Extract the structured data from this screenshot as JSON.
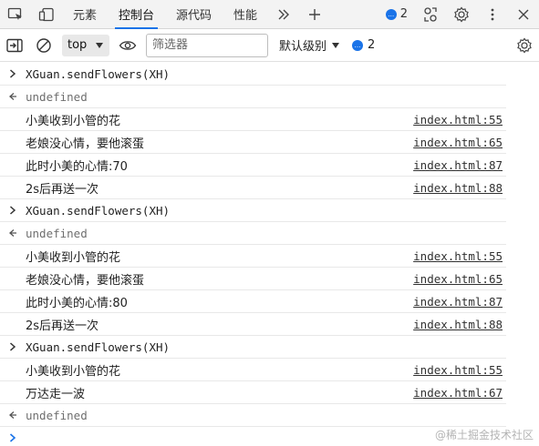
{
  "tabbar": {
    "tabs": [
      {
        "label": "元素",
        "active": false
      },
      {
        "label": "控制台",
        "active": true
      },
      {
        "label": "源代码",
        "active": false
      },
      {
        "label": "性能",
        "active": false
      }
    ],
    "more_icon": "chevron-double-right-icon",
    "add_icon": "plus-icon",
    "message_count": "2",
    "accent_color": "#1a73e8"
  },
  "toolbar": {
    "context": "top",
    "filter_placeholder": "筛选器",
    "filter_value": "",
    "levels_label": "默认级别",
    "issue_count": "2"
  },
  "console": {
    "entries": [
      {
        "kind": "input",
        "text": "XGuan.sendFlowers(XH)",
        "source": ""
      },
      {
        "kind": "result",
        "text": "undefined",
        "source": ""
      },
      {
        "kind": "log",
        "text": "小美收到小管的花",
        "source": "index.html:55"
      },
      {
        "kind": "log",
        "text": "老娘没心情，要他滚蛋",
        "source": "index.html:65"
      },
      {
        "kind": "log",
        "text": "此时小美的心情:70",
        "source": "index.html:87"
      },
      {
        "kind": "log",
        "text": "2s后再送一次",
        "source": "index.html:88"
      },
      {
        "kind": "input",
        "text": "XGuan.sendFlowers(XH)",
        "source": ""
      },
      {
        "kind": "result",
        "text": "undefined",
        "source": ""
      },
      {
        "kind": "log",
        "text": "小美收到小管的花",
        "source": "index.html:55"
      },
      {
        "kind": "log",
        "text": "老娘没心情，要他滚蛋",
        "source": "index.html:65"
      },
      {
        "kind": "log",
        "text": "此时小美的心情:80",
        "source": "index.html:87"
      },
      {
        "kind": "log",
        "text": "2s后再送一次",
        "source": "index.html:88"
      },
      {
        "kind": "input",
        "text": "XGuan.sendFlowers(XH)",
        "source": ""
      },
      {
        "kind": "log",
        "text": "小美收到小管的花",
        "source": "index.html:55"
      },
      {
        "kind": "log",
        "text": "万达走一波",
        "source": "index.html:67"
      },
      {
        "kind": "result",
        "text": "undefined",
        "source": ""
      }
    ]
  },
  "watermark": "@稀土掘金技术社区"
}
